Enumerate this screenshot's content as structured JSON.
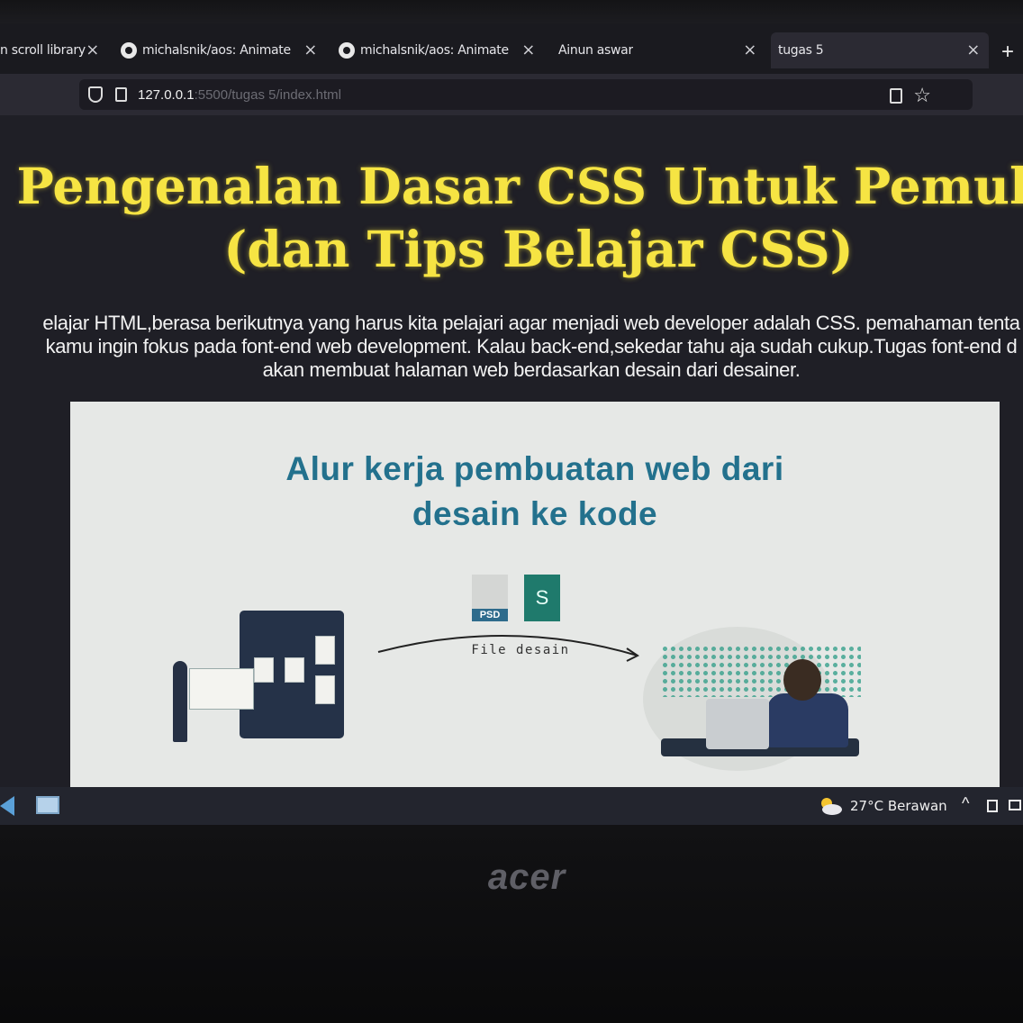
{
  "browser": {
    "tabs": [
      {
        "label": "n scroll library",
        "has_github_icon": false,
        "active": false
      },
      {
        "label": "michalsnik/aos: Animate o",
        "has_github_icon": true,
        "active": false
      },
      {
        "label": "michalsnik/aos: Animate o",
        "has_github_icon": true,
        "active": false
      },
      {
        "label": "Ainun aswar",
        "has_github_icon": false,
        "active": false
      },
      {
        "label": "tugas 5",
        "has_github_icon": false,
        "active": true
      }
    ],
    "close_glyph": "×",
    "new_tab_glyph": "+",
    "url_host": "127.0.0.1",
    "url_rest": ":5500/tugas 5/index.html",
    "star_glyph": "☆"
  },
  "page": {
    "heading": "Pengenalan Dasar CSS Untuk Pemula (dan Tips Belajar CSS)",
    "paragraph": "elajar HTML,berasa berikutnya yang harus kita pelajari agar menjadi web developer adalah CSS. pemahaman tenta\nkamu ingin fokus pada font-end web development. Kalau back-end,sekedar tahu aja sudah cukup.Tugas font-end d\nakan membuat halaman web berdasarkan desain dari desainer.",
    "figure": {
      "heading": "Alur kerja pembuatan web dari desain ke kode",
      "psd_label": "PSD",
      "sketch_label": "S",
      "arrow_label": "File desain"
    }
  },
  "taskbar": {
    "weather": "27°C  Berawan",
    "chevron": "^"
  },
  "device": {
    "logo": "acer"
  }
}
